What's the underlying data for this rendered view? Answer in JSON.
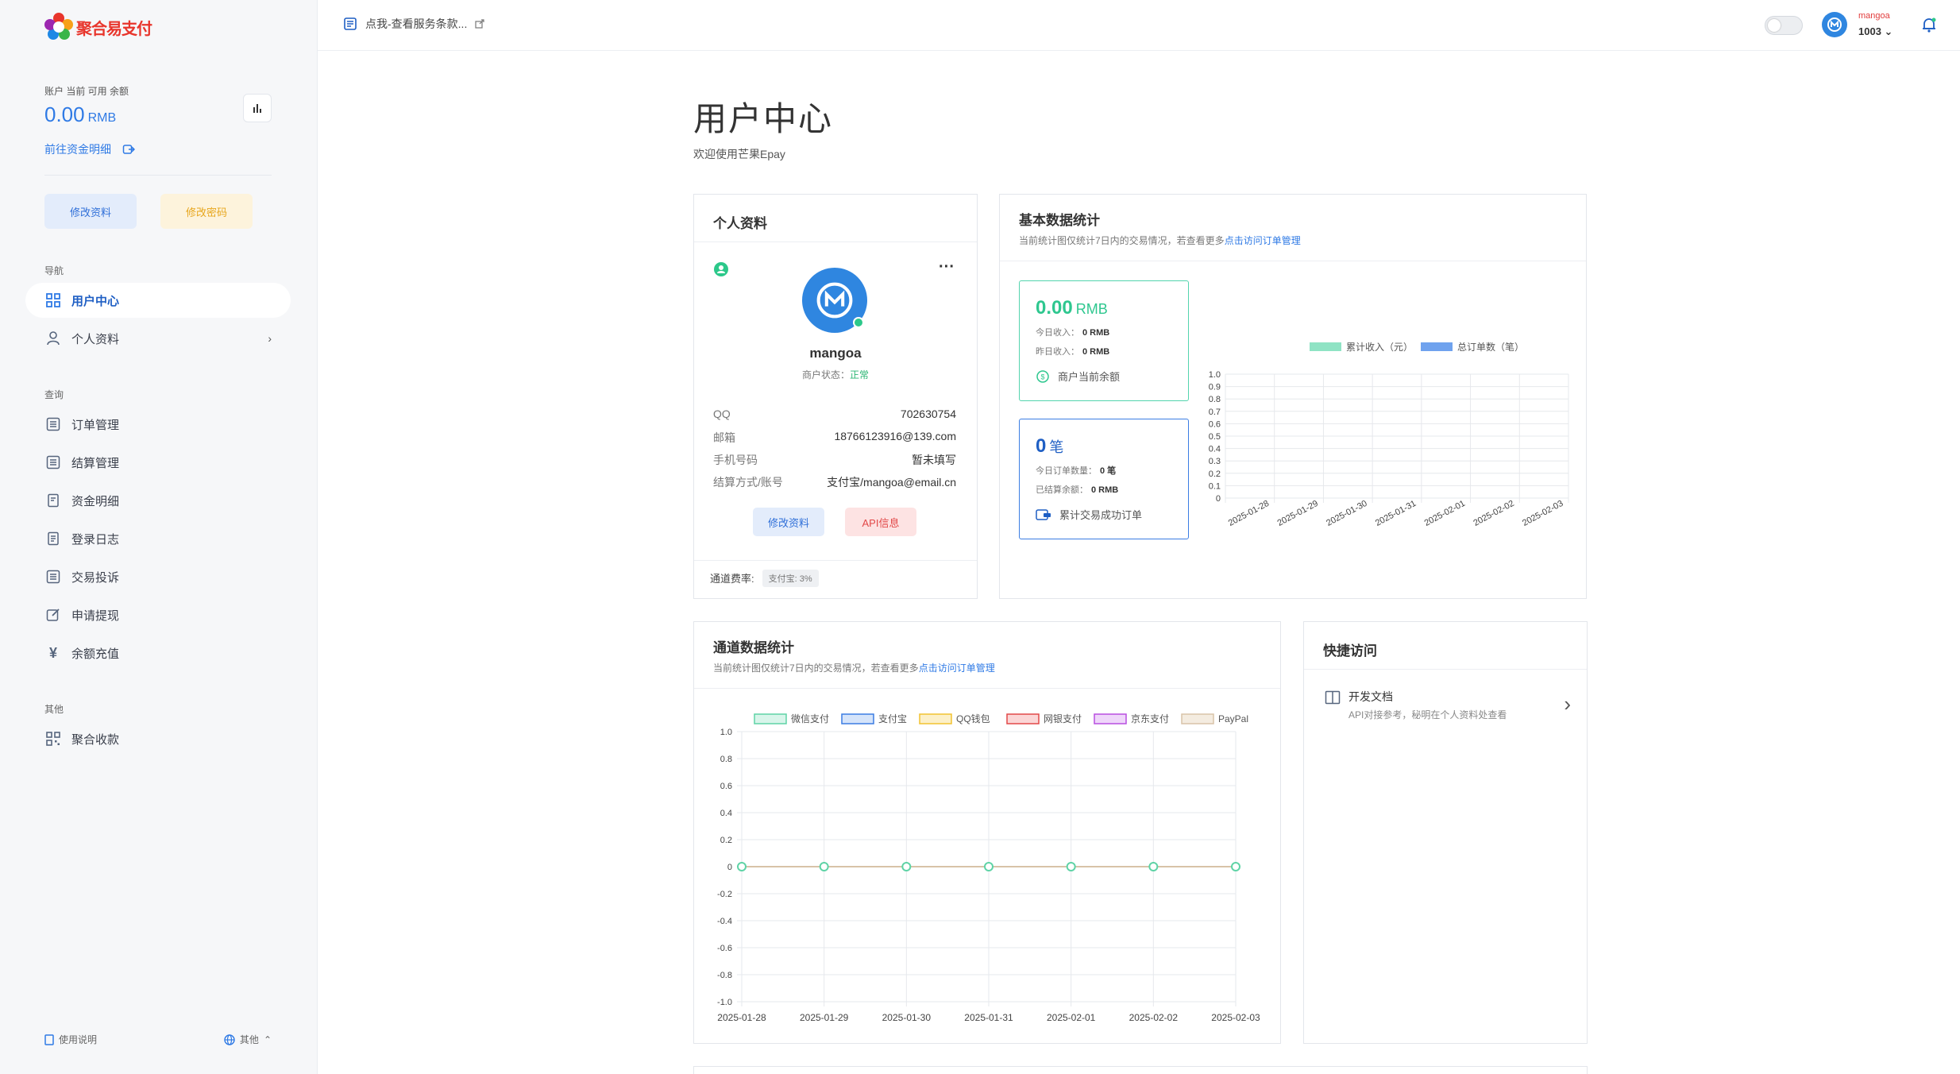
{
  "sidebar": {
    "logo_text": "聚合易支付",
    "balance_label": "账户 当前 可用 余额",
    "balance_value": "0.00",
    "balance_unit": "RMB",
    "fund_link": "前往资金明细",
    "edit_profile_btn": "修改资料",
    "edit_password_btn": "修改密码",
    "section_nav": "导航",
    "section_query": "查询",
    "section_other": "其他",
    "items": [
      {
        "label": "用户中心",
        "icon": "grid-icon"
      },
      {
        "label": "个人资料",
        "icon": "user-icon"
      },
      {
        "label": "订单管理",
        "icon": "list-icon"
      },
      {
        "label": "结算管理",
        "icon": "list-icon"
      },
      {
        "label": "资金明细",
        "icon": "doc-icon"
      },
      {
        "label": "登录日志",
        "icon": "doc-icon"
      },
      {
        "label": "交易投诉",
        "icon": "list-icon"
      },
      {
        "label": "申请提现",
        "icon": "edit-icon"
      },
      {
        "label": "余额充值",
        "icon": "yen-icon"
      },
      {
        "label": "聚合收款",
        "icon": "qrcode-icon"
      }
    ],
    "footer_help": "使用说明",
    "footer_other": "其他"
  },
  "topbar": {
    "notice": "点我-查看服务条款...",
    "user_name": "mangoa",
    "user_id": "1003"
  },
  "page": {
    "title": "用户中心",
    "subtitle": "欢迎使用芒果Epay"
  },
  "profile": {
    "title": "个人资料",
    "name": "mangoa",
    "status_label": "商户状态：",
    "status_value": "正常",
    "rows": [
      {
        "k": "QQ",
        "v": "702630754"
      },
      {
        "k": "邮箱",
        "v": "18766123916@139.com"
      },
      {
        "k": "手机号码",
        "v": "暂未填写"
      },
      {
        "k": "结算方式/账号",
        "v": "支付宝/mangoa@email.cn"
      }
    ],
    "btn_edit": "修改资料",
    "btn_api": "API信息",
    "fee_label": "通道费率:",
    "fee_badge": "支付宝: 3%"
  },
  "stats": {
    "title": "基本数据统计",
    "subtitle": "当前统计图仅统计7日内的交易情况，若查看更多",
    "subtitle_link": "点击访问订单管理",
    "income_value": "0.00",
    "income_unit": "RMB",
    "today_income_label": "今日收入：",
    "today_income": "0 RMB",
    "yesterday_income_label": "昨日收入：",
    "yesterday_income": "0 RMB",
    "income_foot": "商户当前余额",
    "orders_value": "0",
    "orders_unit": "笔",
    "today_orders_label": "今日订单数量：",
    "today_orders": "0 笔",
    "settled_label": "已结算余额：",
    "settled": "0 RMB",
    "orders_foot": "累计交易成功订单"
  },
  "channel": {
    "title": "通道数据统计",
    "subtitle": "当前统计图仅统计7日内的交易情况，若查看更多",
    "subtitle_link": "点击访问订单管理"
  },
  "quick": {
    "title": "快捷访问",
    "item_title": "开发文档",
    "item_desc": "API对接参考，秘明在个人资料处查看"
  },
  "colors": {
    "accent": "#2f7ae5",
    "green": "#2ec78f"
  },
  "chart_data": [
    {
      "type": "bar",
      "categories": [
        "2025-01-28",
        "2025-01-29",
        "2025-01-30",
        "2025-01-31",
        "2025-02-01",
        "2025-02-02",
        "2025-02-03"
      ],
      "series": [
        {
          "name": "累计收入（元）",
          "values": [
            0,
            0,
            0,
            0,
            0,
            0,
            0
          ],
          "color": "#8fe3c4"
        },
        {
          "name": "总订单数（笔）",
          "values": [
            0,
            0,
            0,
            0,
            0,
            0,
            0
          ],
          "color": "#6fa2ee"
        }
      ],
      "ylim": [
        0,
        1.0
      ],
      "yticks": [
        "1.0",
        "0.9",
        "0.8",
        "0.7",
        "0.6",
        "0.5",
        "0.4",
        "0.3",
        "0.2",
        "0.1",
        "0"
      ],
      "legend": "top"
    },
    {
      "type": "line",
      "categories": [
        "2025-01-28",
        "2025-01-29",
        "2025-01-30",
        "2025-01-31",
        "2025-02-01",
        "2025-02-02",
        "2025-02-03"
      ],
      "series": [
        {
          "name": "微信支付",
          "values": [
            0,
            0,
            0,
            0,
            0,
            0,
            0
          ],
          "color": "#5fd3a6",
          "fill": "#d8f5ea"
        },
        {
          "name": "支付宝",
          "values": [
            0,
            0,
            0,
            0,
            0,
            0,
            0
          ],
          "color": "#3b7de3",
          "fill": "#d5e4fa"
        },
        {
          "name": "QQ钱包",
          "values": [
            0,
            0,
            0,
            0,
            0,
            0,
            0
          ],
          "color": "#f2c230",
          "fill": "#fcf0c8"
        },
        {
          "name": "网银支付",
          "values": [
            0,
            0,
            0,
            0,
            0,
            0,
            0
          ],
          "color": "#e24848",
          "fill": "#fbd6d6"
        },
        {
          "name": "京东支付",
          "values": [
            0,
            0,
            0,
            0,
            0,
            0,
            0
          ],
          "color": "#b84fe0",
          "fill": "#efd6fa"
        },
        {
          "name": "PayPal",
          "values": [
            0,
            0,
            0,
            0,
            0,
            0,
            0
          ],
          "color": "#d8c3a8",
          "fill": "#f4ece0"
        }
      ],
      "ylim": [
        -1.0,
        1.0
      ],
      "yticks": [
        "1.0",
        "0.8",
        "0.6",
        "0.4",
        "0.2",
        "0",
        "-0.2",
        "-0.4",
        "-0.6",
        "-0.8",
        "-1.0"
      ],
      "legend": "top"
    }
  ]
}
